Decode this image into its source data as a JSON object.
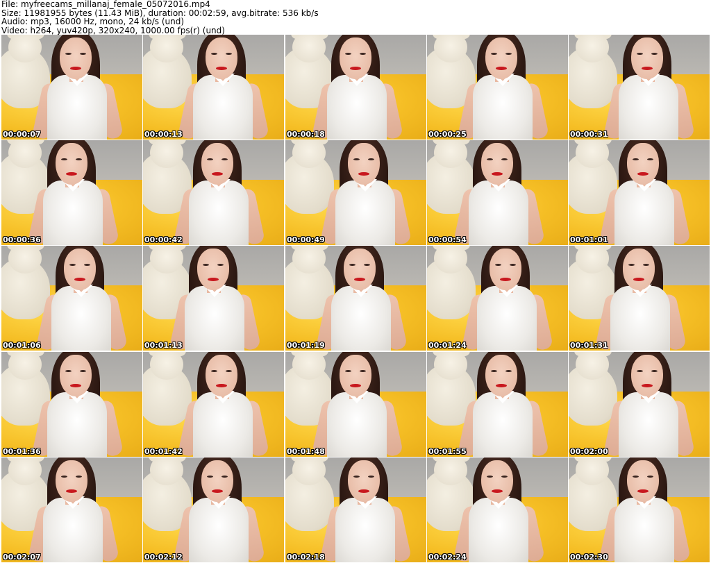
{
  "header": {
    "file_line": "File: myfreecams_millanaj_female_05072016.mp4",
    "size_line": "Size: 11981955 bytes (11.43 MiB), duration: 00:02:59, avg.bitrate: 536 kb/s",
    "audio_line": "Audio: mp3, 16000 Hz, mono, 24 kb/s (und)",
    "video_line": "Video: h264, yuv420p, 320x240, 1000.00 fps(r) (und)"
  },
  "thumbnails": [
    {
      "timestamp": "00:00:07"
    },
    {
      "timestamp": "00:00:13"
    },
    {
      "timestamp": "00:00:18"
    },
    {
      "timestamp": "00:00:25"
    },
    {
      "timestamp": "00:00:31"
    },
    {
      "timestamp": "00:00:36"
    },
    {
      "timestamp": "00:00:42"
    },
    {
      "timestamp": "00:00:49"
    },
    {
      "timestamp": "00:00:54"
    },
    {
      "timestamp": "00:01:01"
    },
    {
      "timestamp": "00:01:06"
    },
    {
      "timestamp": "00:01:13"
    },
    {
      "timestamp": "00:01:19"
    },
    {
      "timestamp": "00:01:24"
    },
    {
      "timestamp": "00:01:31"
    },
    {
      "timestamp": "00:01:36"
    },
    {
      "timestamp": "00:01:42"
    },
    {
      "timestamp": "00:01:48"
    },
    {
      "timestamp": "00:01:55"
    },
    {
      "timestamp": "00:02:00"
    },
    {
      "timestamp": "00:02:07"
    },
    {
      "timestamp": "00:02:12"
    },
    {
      "timestamp": "00:02:18"
    },
    {
      "timestamp": "00:02:24"
    },
    {
      "timestamp": "00:02:30"
    }
  ],
  "colors": {
    "background": "#ffffff",
    "header_text": "#000000",
    "timestamp_text": "#ffffff",
    "timestamp_outline": "#000000"
  }
}
